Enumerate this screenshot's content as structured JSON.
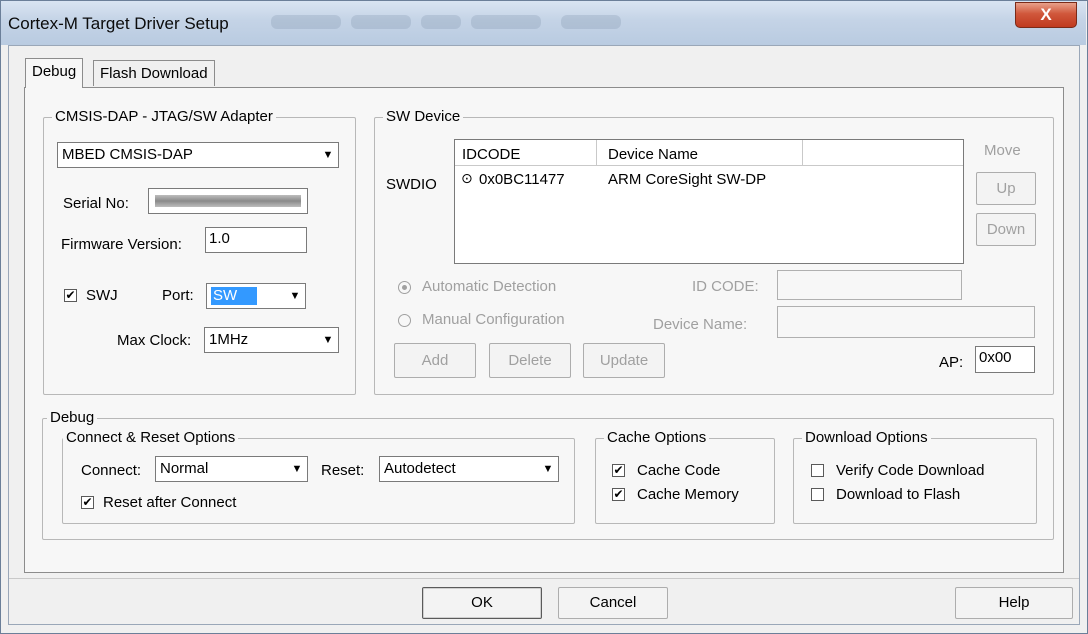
{
  "window": {
    "title": "Cortex-M Target Driver Setup",
    "close_glyph": "X"
  },
  "tabs": [
    {
      "label": "Debug",
      "active": true
    },
    {
      "label": "Flash Download",
      "active": false
    }
  ],
  "adapter": {
    "legend": "CMSIS-DAP - JTAG/SW Adapter",
    "selected": "MBED CMSIS-DAP",
    "serial_label": "Serial No:",
    "firmware_label": "Firmware Version:",
    "firmware_value": "1.0",
    "swj_label": "SWJ",
    "swj_checked": true,
    "port_label": "Port:",
    "port_value": "SW",
    "maxclock_label": "Max Clock:",
    "maxclock_value": "1MHz"
  },
  "sw_device": {
    "legend": "SW Device",
    "row_label": "SWDIO",
    "columns": [
      "IDCODE",
      "Device Name"
    ],
    "rows": [
      {
        "idcode": "0x0BC11477",
        "device_name": "ARM CoreSight SW-DP"
      }
    ],
    "move_label": "Move",
    "up_label": "Up",
    "down_label": "Down",
    "auto_detect_label": "Automatic Detection",
    "manual_config_label": "Manual Configuration",
    "id_code_label": "ID CODE:",
    "device_name_label": "Device Name:",
    "add_label": "Add",
    "delete_label": "Delete",
    "update_label": "Update",
    "ap_label": "AP:",
    "ap_value": "0x00"
  },
  "debug": {
    "legend": "Debug",
    "connect_reset": {
      "legend": "Connect & Reset Options",
      "connect_label": "Connect:",
      "connect_value": "Normal",
      "reset_label": "Reset:",
      "reset_value": "Autodetect",
      "reset_after_connect_label": "Reset after Connect",
      "reset_after_connect_checked": true
    },
    "cache": {
      "legend": "Cache Options",
      "cache_code_label": "Cache Code",
      "cache_code_checked": true,
      "cache_memory_label": "Cache Memory",
      "cache_memory_checked": true
    },
    "download": {
      "legend": "Download Options",
      "verify_label": "Verify Code Download",
      "verify_checked": false,
      "flash_label": "Download to Flash",
      "flash_checked": false
    }
  },
  "footer": {
    "ok_label": "OK",
    "cancel_label": "Cancel",
    "help_label": "Help"
  },
  "icons": {
    "check": "✔",
    "dropdown": "▼",
    "radio_selected": "⊙"
  }
}
